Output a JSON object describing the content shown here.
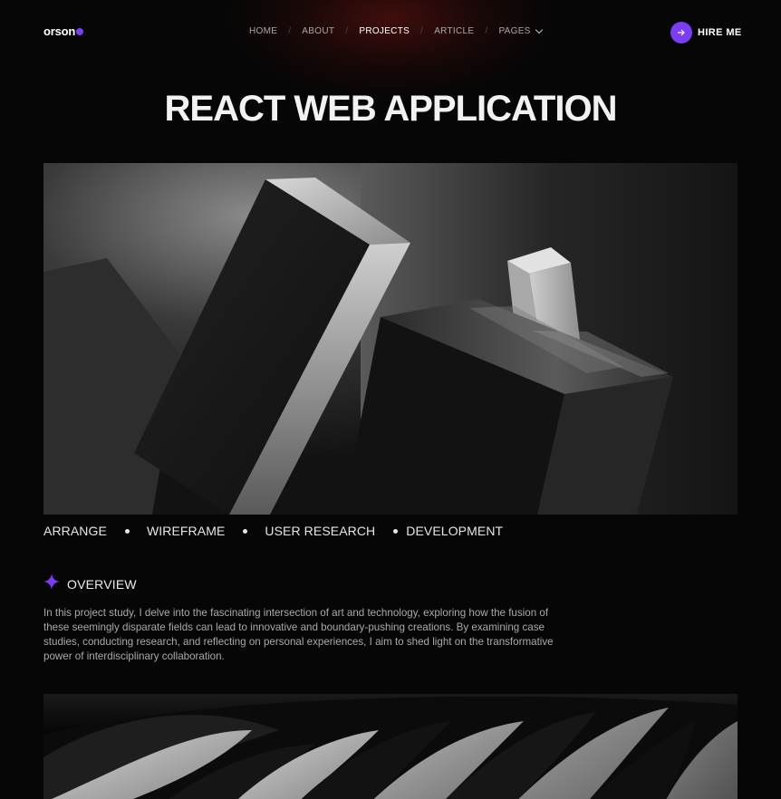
{
  "header": {
    "logo": "orson",
    "nav": [
      {
        "label": "HOME",
        "active": false
      },
      {
        "label": "ABOUT",
        "active": false
      },
      {
        "label": "PROJECTS",
        "active": true
      },
      {
        "label": "ARTICLE",
        "active": false
      },
      {
        "label": "PAGES",
        "active": false,
        "has_dropdown": true
      }
    ],
    "separator": "/",
    "hire_icon": "arrow-right-icon",
    "hire_label": "HIRE ME"
  },
  "title": "REACT WEB APPLICATION",
  "hero_image": {
    "alt_icon": "abstract-3d-blocks-image"
  },
  "tags": [
    "ARRANGE",
    "WIREFRAME",
    "USER RESEARCH",
    "DEVELOPMENT"
  ],
  "overview": {
    "icon": "sparkle-icon",
    "label": "OVERVIEW",
    "text": "In this project study, I delve into the fascinating intersection of art and technology, exploring how the fusion of these seemingly disparate fields can lead to innovative and boundary-pushing creations. By examining case studies, conducting research, and reflecting on personal experiences, I aim to shed light on the transformative power of interdisciplinary collaboration."
  },
  "second_image": {
    "alt_icon": "abstract-waves-image"
  },
  "colors": {
    "accent": "#7b3df2",
    "background": "#060606",
    "text": "#e9e9e9",
    "muted": "#a9a9a9"
  }
}
